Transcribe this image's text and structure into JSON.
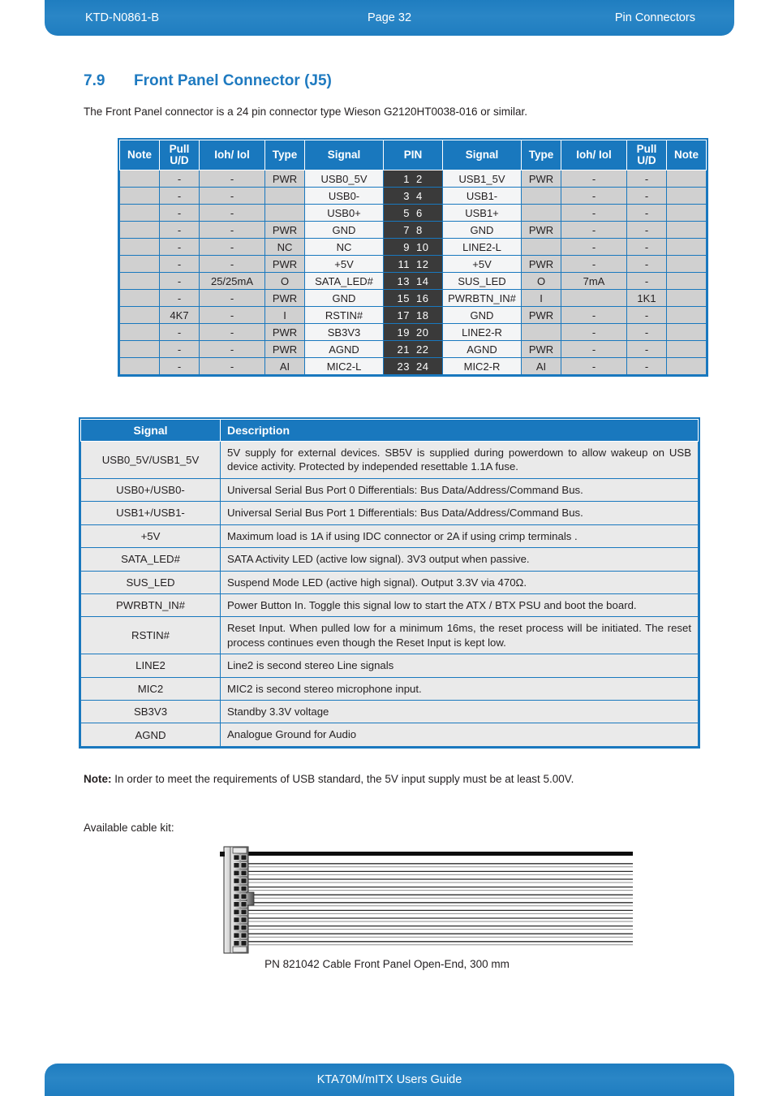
{
  "header": {
    "doc_id": "KTD-N0861-B",
    "page": "Page 32",
    "chapter": "Pin Connectors"
  },
  "footer": {
    "title": "KTA70M/mITX Users Guide"
  },
  "section": {
    "number": "7.9",
    "title": "Front Panel Connector (J5)",
    "intro": "The Front Panel connector is a 24 pin connector type Wieson G2120HT0038-016 or similar."
  },
  "pin_table": {
    "headers": {
      "note_l": "Note",
      "pull_l": "Pull U/D",
      "ioh_l": "Ioh/ Iol",
      "type_l": "Type",
      "signal_l": "Signal",
      "pin": "PIN",
      "signal_r": "Signal",
      "type_r": "Type",
      "ioh_r": "Ioh/ Iol",
      "pull_r": "Pull U/D",
      "note_r": "Note"
    },
    "rows": [
      {
        "note_l": "",
        "pull_l": "-",
        "ioh_l": "-",
        "type_l": "PWR",
        "signal_l": "USB0_5V",
        "pin_a": "1",
        "pin_b": "2",
        "signal_r": "USB1_5V",
        "type_r": "PWR",
        "ioh_r": "-",
        "pull_r": "-",
        "note_r": ""
      },
      {
        "note_l": "",
        "pull_l": "-",
        "ioh_l": "-",
        "type_l": "",
        "signal_l": "USB0-",
        "pin_a": "3",
        "pin_b": "4",
        "signal_r": "USB1-",
        "type_r": "",
        "ioh_r": "-",
        "pull_r": "-",
        "note_r": ""
      },
      {
        "note_l": "",
        "pull_l": "-",
        "ioh_l": "-",
        "type_l": "",
        "signal_l": "USB0+",
        "pin_a": "5",
        "pin_b": "6",
        "signal_r": "USB1+",
        "type_r": "",
        "ioh_r": "-",
        "pull_r": "-",
        "note_r": ""
      },
      {
        "note_l": "",
        "pull_l": "-",
        "ioh_l": "-",
        "type_l": "PWR",
        "signal_l": "GND",
        "pin_a": "7",
        "pin_b": "8",
        "signal_r": "GND",
        "type_r": "PWR",
        "ioh_r": "-",
        "pull_r": "-",
        "note_r": ""
      },
      {
        "note_l": "",
        "pull_l": "-",
        "ioh_l": "-",
        "type_l": "NC",
        "signal_l": "NC",
        "pin_a": "9",
        "pin_b": "10",
        "signal_r": "LINE2-L",
        "type_r": "",
        "ioh_r": "-",
        "pull_r": "-",
        "note_r": ""
      },
      {
        "note_l": "",
        "pull_l": "-",
        "ioh_l": "-",
        "type_l": "PWR",
        "signal_l": "+5V",
        "pin_a": "11",
        "pin_b": "12",
        "signal_r": "+5V",
        "type_r": "PWR",
        "ioh_r": "-",
        "pull_r": "-",
        "note_r": ""
      },
      {
        "note_l": "",
        "pull_l": "-",
        "ioh_l": "25/25mA",
        "type_l": "O",
        "signal_l": "SATA_LED#",
        "pin_a": "13",
        "pin_b": "14",
        "signal_r": "SUS_LED",
        "type_r": "O",
        "ioh_r": "7mA",
        "pull_r": "-",
        "note_r": ""
      },
      {
        "note_l": "",
        "pull_l": "-",
        "ioh_l": "-",
        "type_l": "PWR",
        "signal_l": "GND",
        "pin_a": "15",
        "pin_b": "16",
        "signal_r": "PWRBTN_IN#",
        "type_r": "I",
        "ioh_r": "",
        "pull_r": "1K1",
        "note_r": ""
      },
      {
        "note_l": "",
        "pull_l": "4K7",
        "ioh_l": "-",
        "type_l": "I",
        "signal_l": "RSTIN#",
        "pin_a": "17",
        "pin_b": "18",
        "signal_r": "GND",
        "type_r": "PWR",
        "ioh_r": "-",
        "pull_r": "-",
        "note_r": ""
      },
      {
        "note_l": "",
        "pull_l": "-",
        "ioh_l": "-",
        "type_l": "PWR",
        "signal_l": "SB3V3",
        "pin_a": "19",
        "pin_b": "20",
        "signal_r": "LINE2-R",
        "type_r": "",
        "ioh_r": "-",
        "pull_r": "-",
        "note_r": ""
      },
      {
        "note_l": "",
        "pull_l": "-",
        "ioh_l": "-",
        "type_l": "PWR",
        "signal_l": "AGND",
        "pin_a": "21",
        "pin_b": "22",
        "signal_r": "AGND",
        "type_r": "PWR",
        "ioh_r": "-",
        "pull_r": "-",
        "note_r": ""
      },
      {
        "note_l": "",
        "pull_l": "-",
        "ioh_l": "-",
        "type_l": "AI",
        "signal_l": "MIC2-L",
        "pin_a": "23",
        "pin_b": "24",
        "signal_r": "MIC2-R",
        "type_r": "AI",
        "ioh_r": "-",
        "pull_r": "-",
        "note_r": ""
      }
    ]
  },
  "desc_table": {
    "headers": {
      "signal": "Signal",
      "description": "Description"
    },
    "rows": [
      {
        "signal": "USB0_5V/USB1_5V",
        "description": "5V supply for external devices.  SB5V is supplied during powerdown to allow wakeup on USB device activity. Protected by independed resettable 1.1A fuse."
      },
      {
        "signal": "USB0+/USB0-",
        "description": "Universal Serial Bus Port 0 Differentials: Bus Data/Address/Command Bus."
      },
      {
        "signal": "USB1+/USB1-",
        "description": "Universal Serial Bus Port 1 Differentials: Bus Data/Address/Command Bus."
      },
      {
        "signal": "+5V",
        "description": "Maximum load is 1A if using IDC connector or 2A if using crimp terminals ."
      },
      {
        "signal": "SATA_LED#",
        "description": "SATA Activity LED (active low signal). 3V3 output when passive."
      },
      {
        "signal": "SUS_LED",
        "description": "Suspend Mode LED (active high signal). Output 3.3V via 470Ω."
      },
      {
        "signal": "PWRBTN_IN#",
        "description": "Power Button In. Toggle this signal low to start the ATX / BTX PSU and boot the board."
      },
      {
        "signal": "RSTIN#",
        "description": "Reset Input. When pulled low for a minimum 16ms, the reset process will be initiated. The reset process continues even though the Reset Input is kept low."
      },
      {
        "signal": "LINE2",
        "description": "Line2 is second stereo Line signals"
      },
      {
        "signal": "MIC2",
        "description": "MIC2 is second stereo microphone input."
      },
      {
        "signal": "SB3V3",
        "description": "Standby 3.3V voltage"
      },
      {
        "signal": "AGND",
        "description": "Analogue Ground for Audio"
      }
    ]
  },
  "note": {
    "label": "Note:",
    "text": " In order to meet the requirements of USB standard, the 5V input supply must be at least 5.00V."
  },
  "cable": {
    "label": "Available cable kit:",
    "caption": "PN 821042 Cable Front Panel Open-End, 300 mm",
    "pin_rows": 12
  },
  "colors": {
    "brand_blue": "#1978be",
    "header_bar": "#2a86c6",
    "pin_column": "#3a3a3a",
    "cell_gray": "#d0d0d0",
    "desc_gray": "#eaeaea"
  }
}
